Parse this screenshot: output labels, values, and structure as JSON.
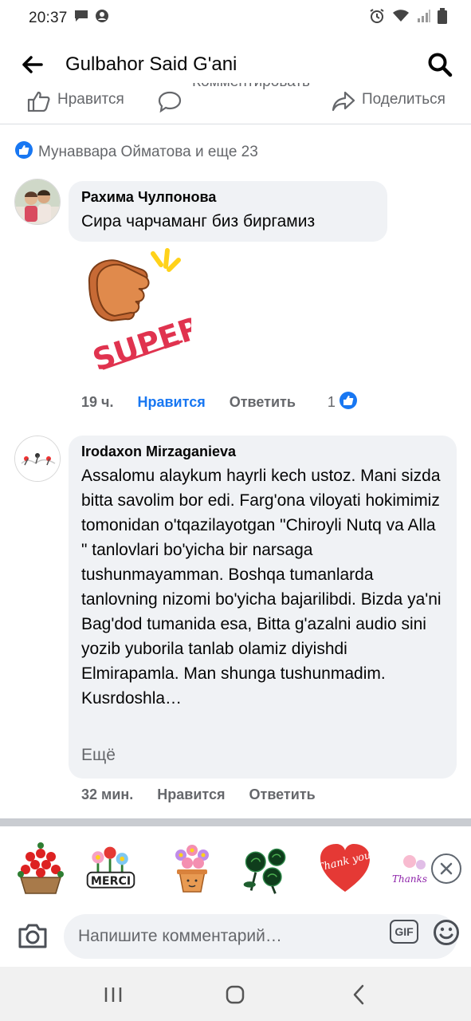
{
  "status_bar": {
    "time": "20:37"
  },
  "header": {
    "title": "Gulbahor Said G'ani"
  },
  "post_actions": {
    "like": "Нравится",
    "comment": "Комментировать",
    "share": "Поделиться"
  },
  "reactions": {
    "text": "Мунаввара Ойматова и еще 23"
  },
  "comments": [
    {
      "author": "Рахима Чулпонова",
      "text": "Сира чарчаманг биз биргамиз",
      "sticker_text": "SUPER!",
      "time": "19 ч.",
      "like_label": "Нравится",
      "reply_label": "Ответить",
      "like_count": "1"
    },
    {
      "author": "Irodaxon Mirzaganieva",
      "text": "Assalomu alaykum hayrli kech ustoz. Mani sizda bitta savolim bor edi. Farg'ona viloyati hokimimiz tomonidan o'tqazilayotgan \"Chiroyli Nutq va Alla \" tanlovlari bo'yicha bir narsaga tushunmayamman. Boshqa tumanlarda tanlovning nizomi bo'yicha bajarilibdi. Bizda ya'ni Bag'dod tumanida esa, Bitta g'azalni audio sini yozib yuborila tanlab olamiz diyishdi Elmirapamla. Man shunga tushunmadim. Kusrdoshla…",
      "more": "Ещё",
      "time": "32 мин.",
      "like_label": "Нравится",
      "reply_label": "Ответить"
    }
  ],
  "stickers": {
    "items": [
      "rose-basket",
      "merci",
      "flower-pot",
      "black-roses",
      "heart-thank-you",
      "thanks"
    ],
    "merci_text": "MERCI",
    "thank_you_text": "Thank you",
    "thanks_text": "Thanks"
  },
  "composer": {
    "placeholder": "Напишите комментарий…",
    "gif_label": "GIF"
  },
  "colors": {
    "accent": "#1877f2",
    "bubble": "#f0f2f5",
    "muted": "#65676b"
  }
}
